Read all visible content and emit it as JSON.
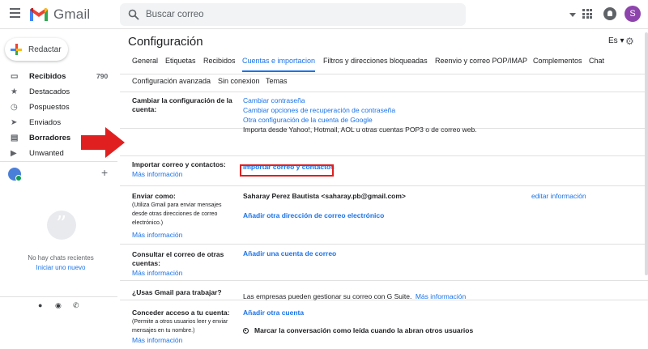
{
  "app": {
    "logo_text": "Gmail",
    "avatar_letter": "S"
  },
  "search": {
    "placeholder": "Buscar correo"
  },
  "sidebar": {
    "compose_label": "Redactar",
    "items": [
      {
        "label": "Recibidos",
        "count": "790",
        "bold": true,
        "icon": "inbox-icon"
      },
      {
        "label": "Destacados",
        "count": "",
        "bold": false,
        "icon": "star-icon"
      },
      {
        "label": "Pospuestos",
        "count": "",
        "bold": false,
        "icon": "clock-icon"
      },
      {
        "label": "Enviados",
        "count": "",
        "bold": false,
        "icon": "send-icon"
      },
      {
        "label": "Borradores",
        "count": "",
        "bold": true,
        "icon": "draft-icon"
      },
      {
        "label": "Unwanted",
        "count": "",
        "bold": false,
        "icon": "label-icon"
      }
    ],
    "no_chats": "No hay chats recientes",
    "new_chat": "Iniciar uno nuevo"
  },
  "settings": {
    "title": "Configuración",
    "lang": "Es",
    "tabs_row1": [
      "General",
      "Etiquetas",
      "Recibidos",
      "Cuentas e importacion",
      "Filtros y direcciones bloqueadas",
      "Reenvio y correo POP/IMAP",
      "Complementos",
      "Chat"
    ],
    "tabs_row2": [
      "Configuración avanzada",
      "Sin conexion",
      "Temas"
    ],
    "active_tab": "Cuentas e importacion",
    "rows": {
      "change_account": {
        "label": "Cambiar la configuración de la cuenta:",
        "links": [
          "Cambiar contraseña",
          "Cambiar opciones de recuperación de contraseña",
          "Otra configuración de la cuenta de Google"
        ]
      },
      "import": {
        "label": "Importar correo y contactos:",
        "more": "Más información",
        "desc": "Importa desde Yahoo!, Hotmail, AOL u otras cuentas POP3 o de correo web.",
        "action": "Importar correo y contactos"
      },
      "send_as": {
        "label": "Enviar como:",
        "sub": "(Utiliza Gmail para enviar mensajes desde otras direcciones de correo electrónico.)",
        "more": "Más información",
        "address": "Saharay Perez Bautista <saharay.pb@gmail.com>",
        "edit": "editar información",
        "add": "Añadir otra dirección de correo electrónico"
      },
      "check_mail": {
        "label": "Consultar el correo de otras cuentas:",
        "more": "Más información",
        "add": "Añadir una cuenta de correo"
      },
      "work": {
        "label": "¿Usas Gmail para trabajar?",
        "text": "Las empresas pueden gestionar su correo con G Suite.",
        "more": "Más información"
      },
      "grant": {
        "label": "Conceder acceso a tu cuenta:",
        "sub": "(Permite a otros usuarios leer y enviar mensajes en tu nombre.)",
        "more": "Más información",
        "add": "Añadir otra cuenta",
        "option": "Marcar la conversación como leída cuando la abran otros usuarios"
      }
    }
  },
  "colors": {
    "accent": "#1a73e8",
    "highlight": "#e02020"
  }
}
